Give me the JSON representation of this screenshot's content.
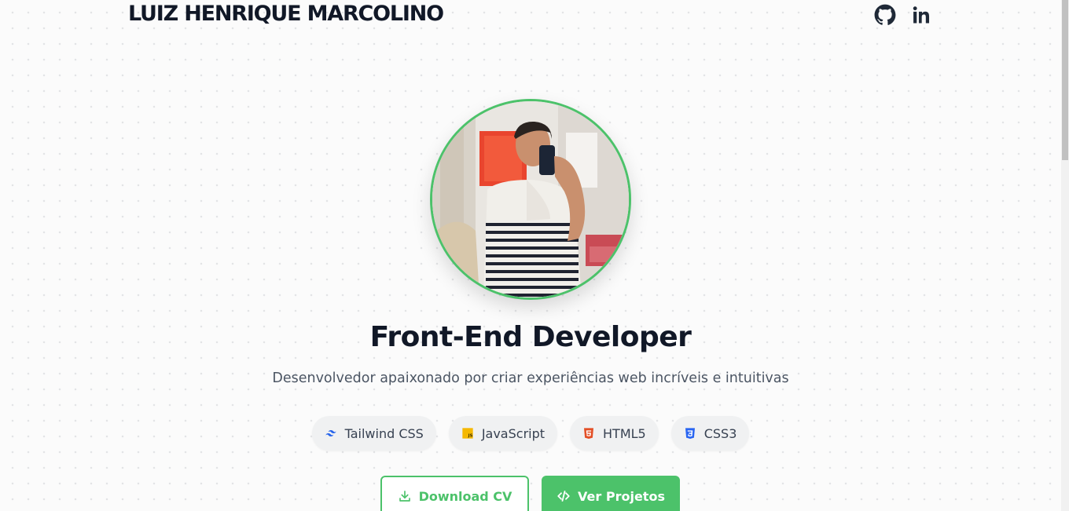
{
  "header": {
    "brand_name": "LUIZ HENRIQUE MARCOLINO",
    "social": [
      {
        "name": "GitHub",
        "icon": "github-icon"
      },
      {
        "name": "LinkedIn",
        "icon": "linkedin-icon"
      }
    ]
  },
  "hero": {
    "headline": "Front-End Developer",
    "subtitle": "Desenvolvedor apaixonado por criar experiências web incríveis e intuitivas",
    "technologies": [
      {
        "label": "Tailwind CSS",
        "icon": "tailwind-icon",
        "color": "#38bdf8"
      },
      {
        "label": "JavaScript",
        "icon": "javascript-icon",
        "color": "#f7df1e"
      },
      {
        "label": "HTML5",
        "icon": "html5-icon",
        "color": "#e34f26"
      },
      {
        "label": "CSS3",
        "icon": "css3-icon",
        "color": "#1572b6"
      }
    ],
    "actions": {
      "download_cv_label": "Download CV",
      "projects_label": "Ver Projetos"
    }
  },
  "colors": {
    "accent": "#4cc26a",
    "text_dark": "#111827",
    "text_muted": "#4b5563"
  }
}
